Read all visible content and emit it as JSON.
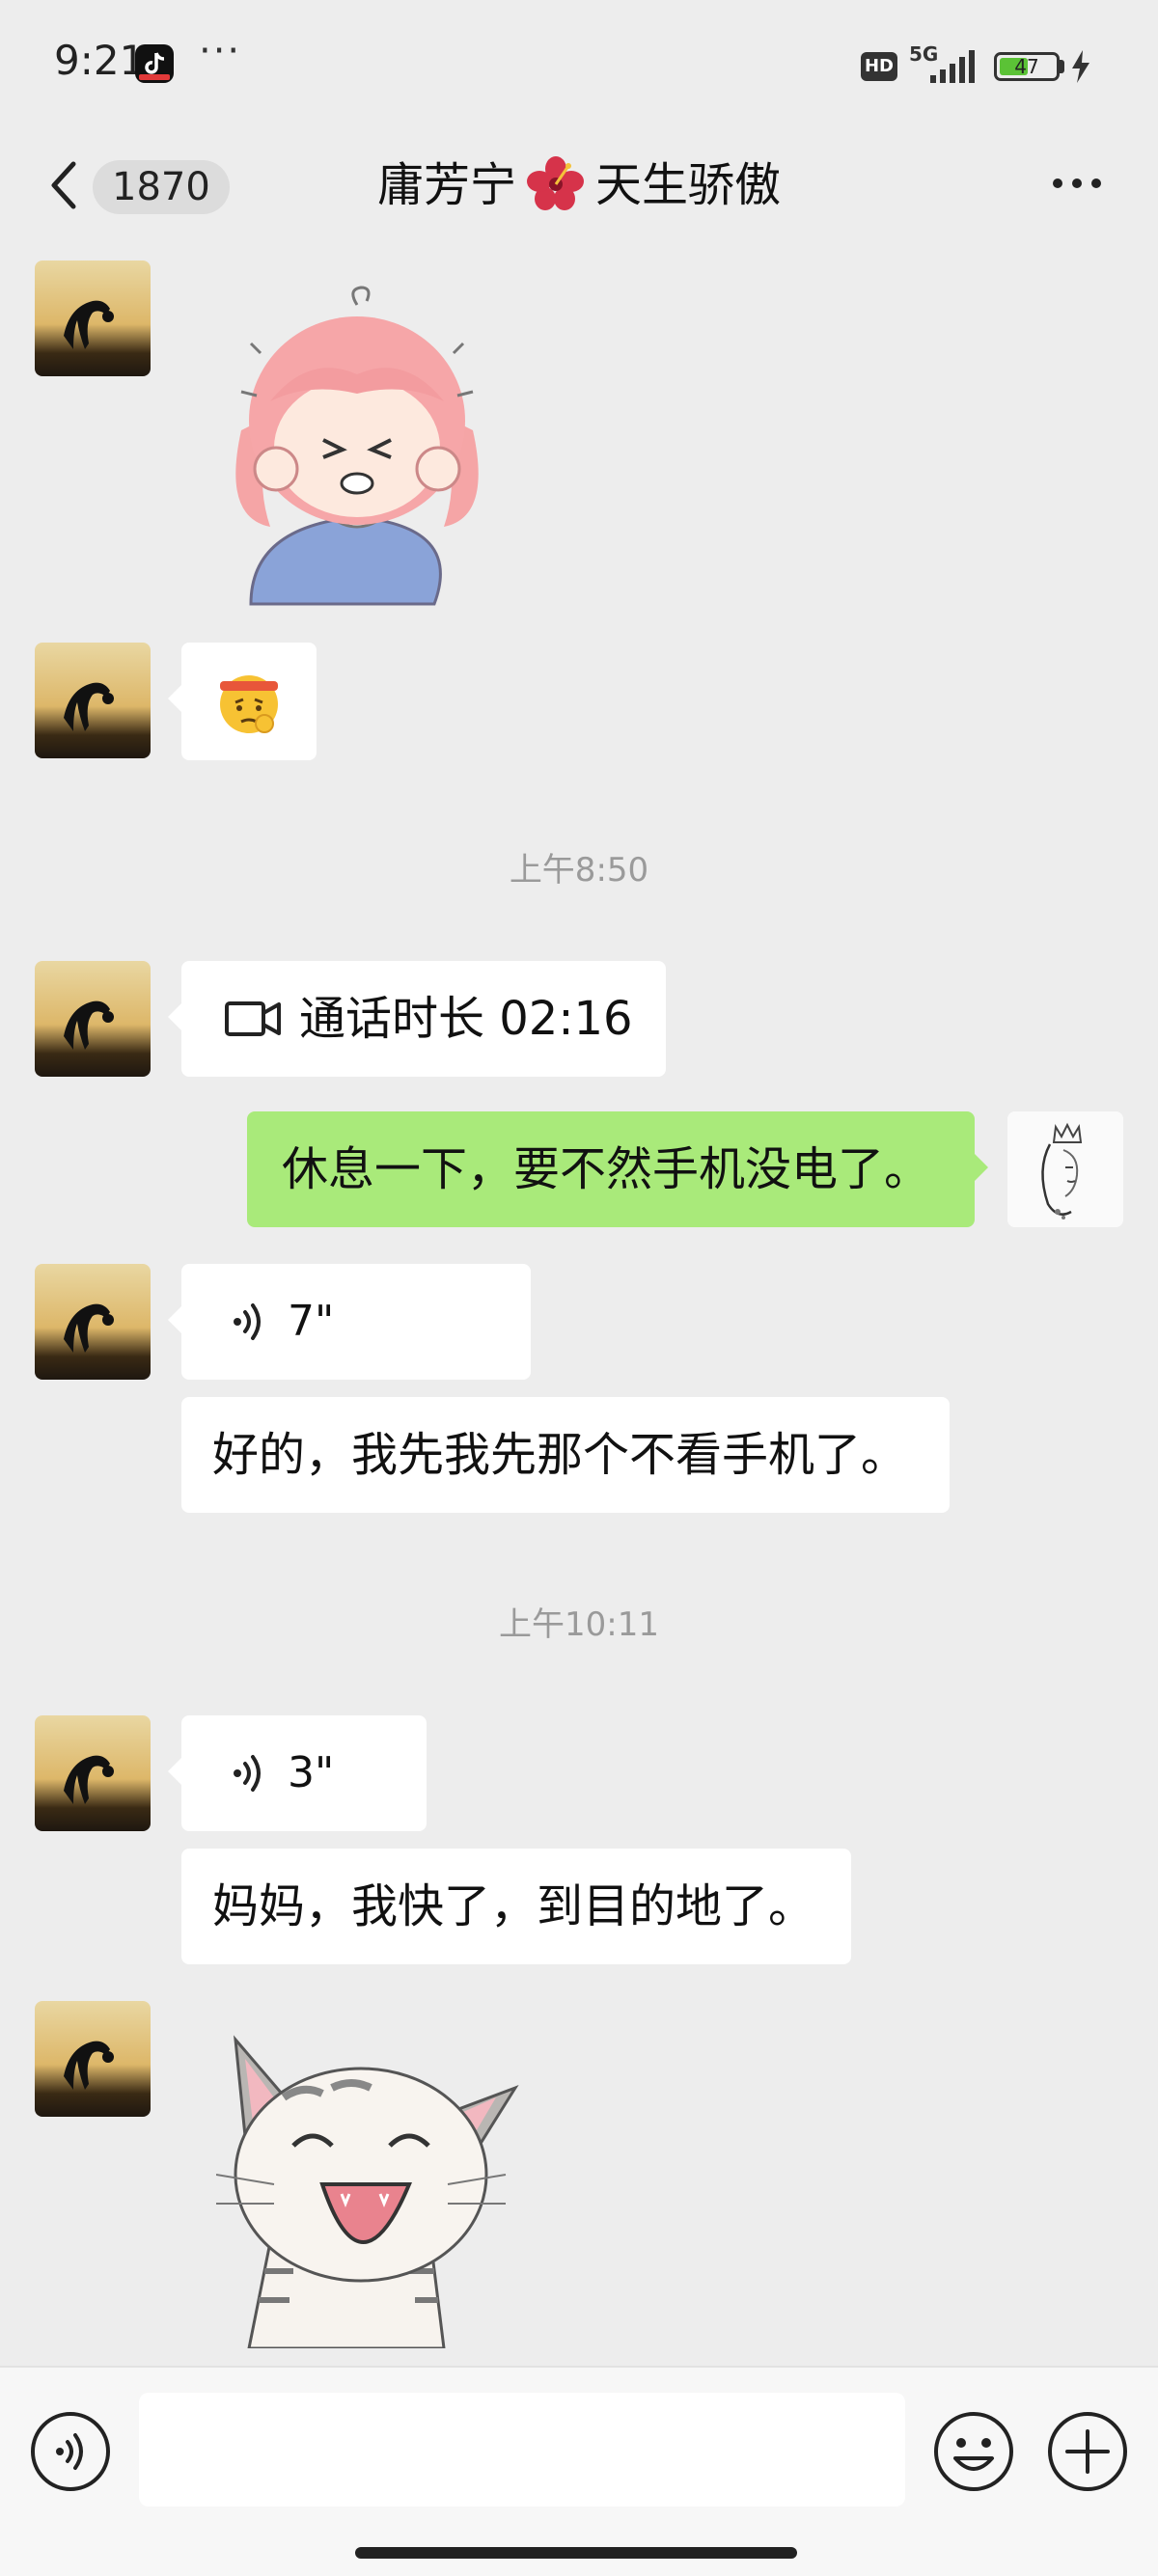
{
  "status_bar": {
    "time": "9:21",
    "more_dots": "···",
    "hd": "HD",
    "network": "5G",
    "battery": "47",
    "battery_level": 0.47
  },
  "header": {
    "unread_count": "1870",
    "title_part1": "庸芳宁",
    "title_part2": "天生骄傲"
  },
  "messages": {
    "call": {
      "label": "通话时长 02:16"
    },
    "sent_text": "休息一下，要不然手机没电了。",
    "voice_1": "7\"",
    "text_1": "好的，我先我先那个不看手机了。",
    "timestamp_1": "上午8:50",
    "timestamp_2": "上午10:11",
    "voice_2": "3\"",
    "text_2": "妈妈，我快了，到目的地了。"
  },
  "input_bar": {
    "placeholder": ""
  },
  "colors": {
    "background": "#ededed",
    "sent_bubble": "#a9ea7a",
    "received_bubble": "#ffffff",
    "timestamp": "#9a9a9a"
  }
}
